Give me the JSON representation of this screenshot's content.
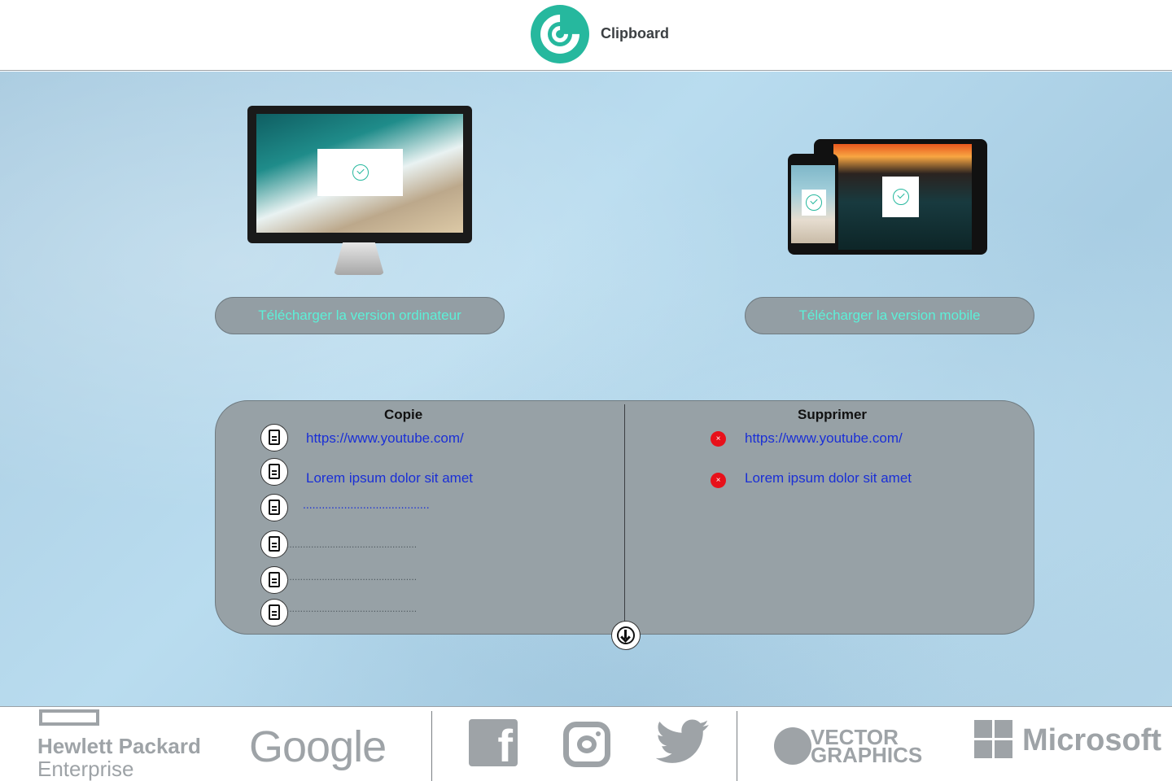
{
  "header": {
    "title": "Clipboard"
  },
  "downloads": {
    "desktop_label": "Télécharger la version ordinateur",
    "mobile_label": "Télécharger la version  mobile"
  },
  "clipboard": {
    "copy_title": "Copie",
    "delete_title": "Supprimer",
    "copy_items": [
      "https://www.youtube.com/",
      "Lorem ipsum dolor sit amet",
      "........................................",
      "................................................",
      "................................................",
      "................................................"
    ],
    "delete_items": [
      "https://www.youtube.com/",
      "Lorem ipsum dolor sit amet"
    ],
    "delete_icon": "×"
  },
  "footer": {
    "logos": [
      {
        "name": "hpe",
        "line1": "Hewlett Packard",
        "line2": "Enterprise"
      },
      {
        "name": "google",
        "text": "Google"
      },
      {
        "name": "facebook",
        "text": "f"
      },
      {
        "name": "instagram"
      },
      {
        "name": "twitter"
      },
      {
        "name": "vector-graphics",
        "line1": "VECTOR",
        "line2": "GRAPHICS"
      },
      {
        "name": "microsoft",
        "text": "Microsoft"
      }
    ]
  },
  "colors": {
    "brand": "#26b89e",
    "button_text": "#5cf0d8",
    "link": "#1a2fd6",
    "delete": "#e8101a"
  }
}
